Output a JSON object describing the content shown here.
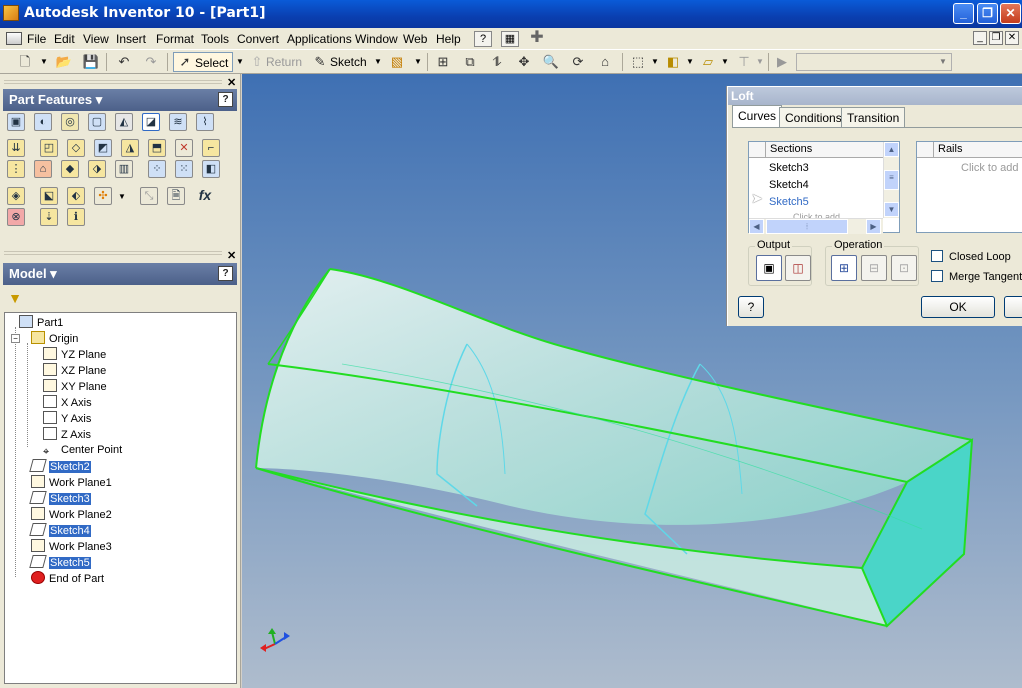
{
  "window": {
    "title": "Autodesk Inventor 10 - [Part1]"
  },
  "menu": [
    "File",
    "Edit",
    "View",
    "Insert",
    "Format",
    "Tools",
    "Convert",
    "Applications",
    "Window",
    "Web",
    "Help"
  ],
  "toolbar": {
    "select_label": "Select",
    "return_label": "Return",
    "sketch_label": "Sketch"
  },
  "panels": {
    "features": {
      "title": "Part Features ▾",
      "fx": "fx"
    },
    "model": {
      "title": "Model ▾"
    }
  },
  "tree": [
    {
      "label": "Part1",
      "selected": false,
      "icon": "part-icon"
    },
    {
      "label": "Origin",
      "selected": false,
      "icon": "folder-icon"
    },
    {
      "label": "YZ Plane",
      "selected": false,
      "icon": "plane-icon"
    },
    {
      "label": "XZ Plane",
      "selected": false,
      "icon": "plane-icon"
    },
    {
      "label": "XY Plane",
      "selected": false,
      "icon": "plane-icon"
    },
    {
      "label": "X Axis",
      "selected": false,
      "icon": "axis-icon"
    },
    {
      "label": "Y Axis",
      "selected": false,
      "icon": "axis-icon"
    },
    {
      "label": "Z Axis",
      "selected": false,
      "icon": "axis-icon"
    },
    {
      "label": "Center Point",
      "selected": false,
      "icon": "point-icon"
    },
    {
      "label": "Sketch2",
      "selected": true,
      "icon": "sketch-icon"
    },
    {
      "label": "Work Plane1",
      "selected": false,
      "icon": "workplane-icon"
    },
    {
      "label": "Sketch3",
      "selected": true,
      "icon": "sketch-icon"
    },
    {
      "label": "Work Plane2",
      "selected": false,
      "icon": "workplane-icon"
    },
    {
      "label": "Sketch4",
      "selected": true,
      "icon": "sketch-icon"
    },
    {
      "label": "Work Plane3",
      "selected": false,
      "icon": "workplane-icon"
    },
    {
      "label": "Sketch5",
      "selected": true,
      "icon": "sketch-icon"
    },
    {
      "label": "End of Part",
      "selected": false,
      "icon": "end-of-part-icon"
    }
  ],
  "loft": {
    "title": "Loft",
    "tabs": [
      "Curves",
      "Conditions",
      "Transition"
    ],
    "active_tab": "Curves",
    "sections_header": "Sections",
    "rails_header": "Rails",
    "sections": [
      "Sketch3",
      "Sketch4",
      "Sketch5"
    ],
    "sections_placeholder": "Click to add",
    "rails_placeholder": "Click to add",
    "output_label": "Output",
    "operation_label": "Operation",
    "closed_loop_label": "Closed Loop",
    "merge_tangent_label": "Merge Tangent",
    "ok_label": "OK",
    "help_glyph": "?"
  },
  "colors": {
    "edge": "#22dd22",
    "face": "#55e0d0",
    "selection": "#316ac5"
  }
}
